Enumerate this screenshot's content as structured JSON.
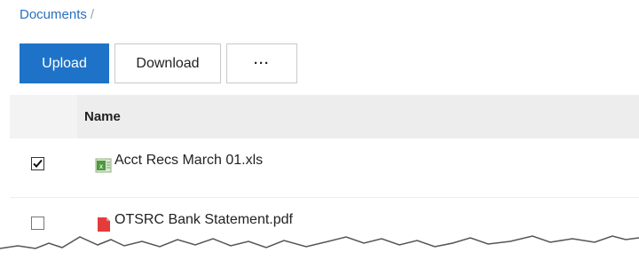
{
  "breadcrumb": {
    "root": "Documents",
    "separator": "/"
  },
  "toolbar": {
    "upload": "Upload",
    "download": "Download",
    "more": "···"
  },
  "table": {
    "header": {
      "name": "Name"
    },
    "rows": [
      {
        "name": "Acct Recs March 01.xls",
        "checked": true,
        "icon": "excel-file-icon"
      },
      {
        "name": "OTSRC Bank Statement.pdf",
        "checked": false,
        "icon": "pdf-file-icon"
      }
    ]
  },
  "colors": {
    "accent": "#1e73c8",
    "link": "#2a6fbd"
  }
}
